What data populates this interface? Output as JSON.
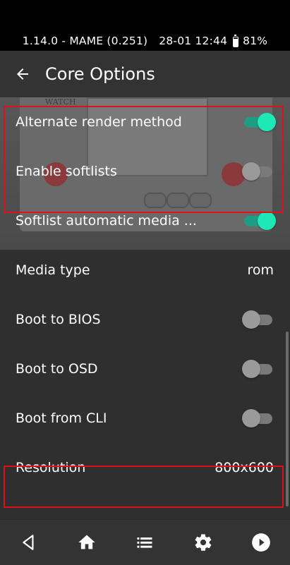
{
  "status_bar": {
    "app_version": "1.14.0 - MAME (0.251)",
    "datetime": "28-01 12:44",
    "battery": "81%"
  },
  "app_bar": {
    "title": "Core Options"
  },
  "options": [
    {
      "label": "Alternate render method",
      "type": "toggle",
      "on": true
    },
    {
      "label": "Enable softlists",
      "type": "toggle",
      "on": false
    },
    {
      "label": "Softlist automatic media ...",
      "type": "toggle",
      "on": true
    },
    {
      "label": "Media type",
      "type": "value",
      "value": "rom"
    },
    {
      "label": "Boot to BIOS",
      "type": "toggle",
      "on": false
    },
    {
      "label": "Boot to OSD",
      "type": "toggle",
      "on": false
    },
    {
      "label": "Boot from CLI",
      "type": "toggle",
      "on": false
    },
    {
      "label": "Resolution",
      "type": "value",
      "value": "800x600"
    }
  ],
  "background_art": {
    "device_text": "WATCH"
  },
  "colors": {
    "accent": "#1de9b6",
    "highlight": "#e0101a",
    "background": "#2f2f2f"
  },
  "bottom_nav": [
    "back-icon",
    "home-icon",
    "list-icon",
    "gear-icon",
    "play-icon"
  ]
}
